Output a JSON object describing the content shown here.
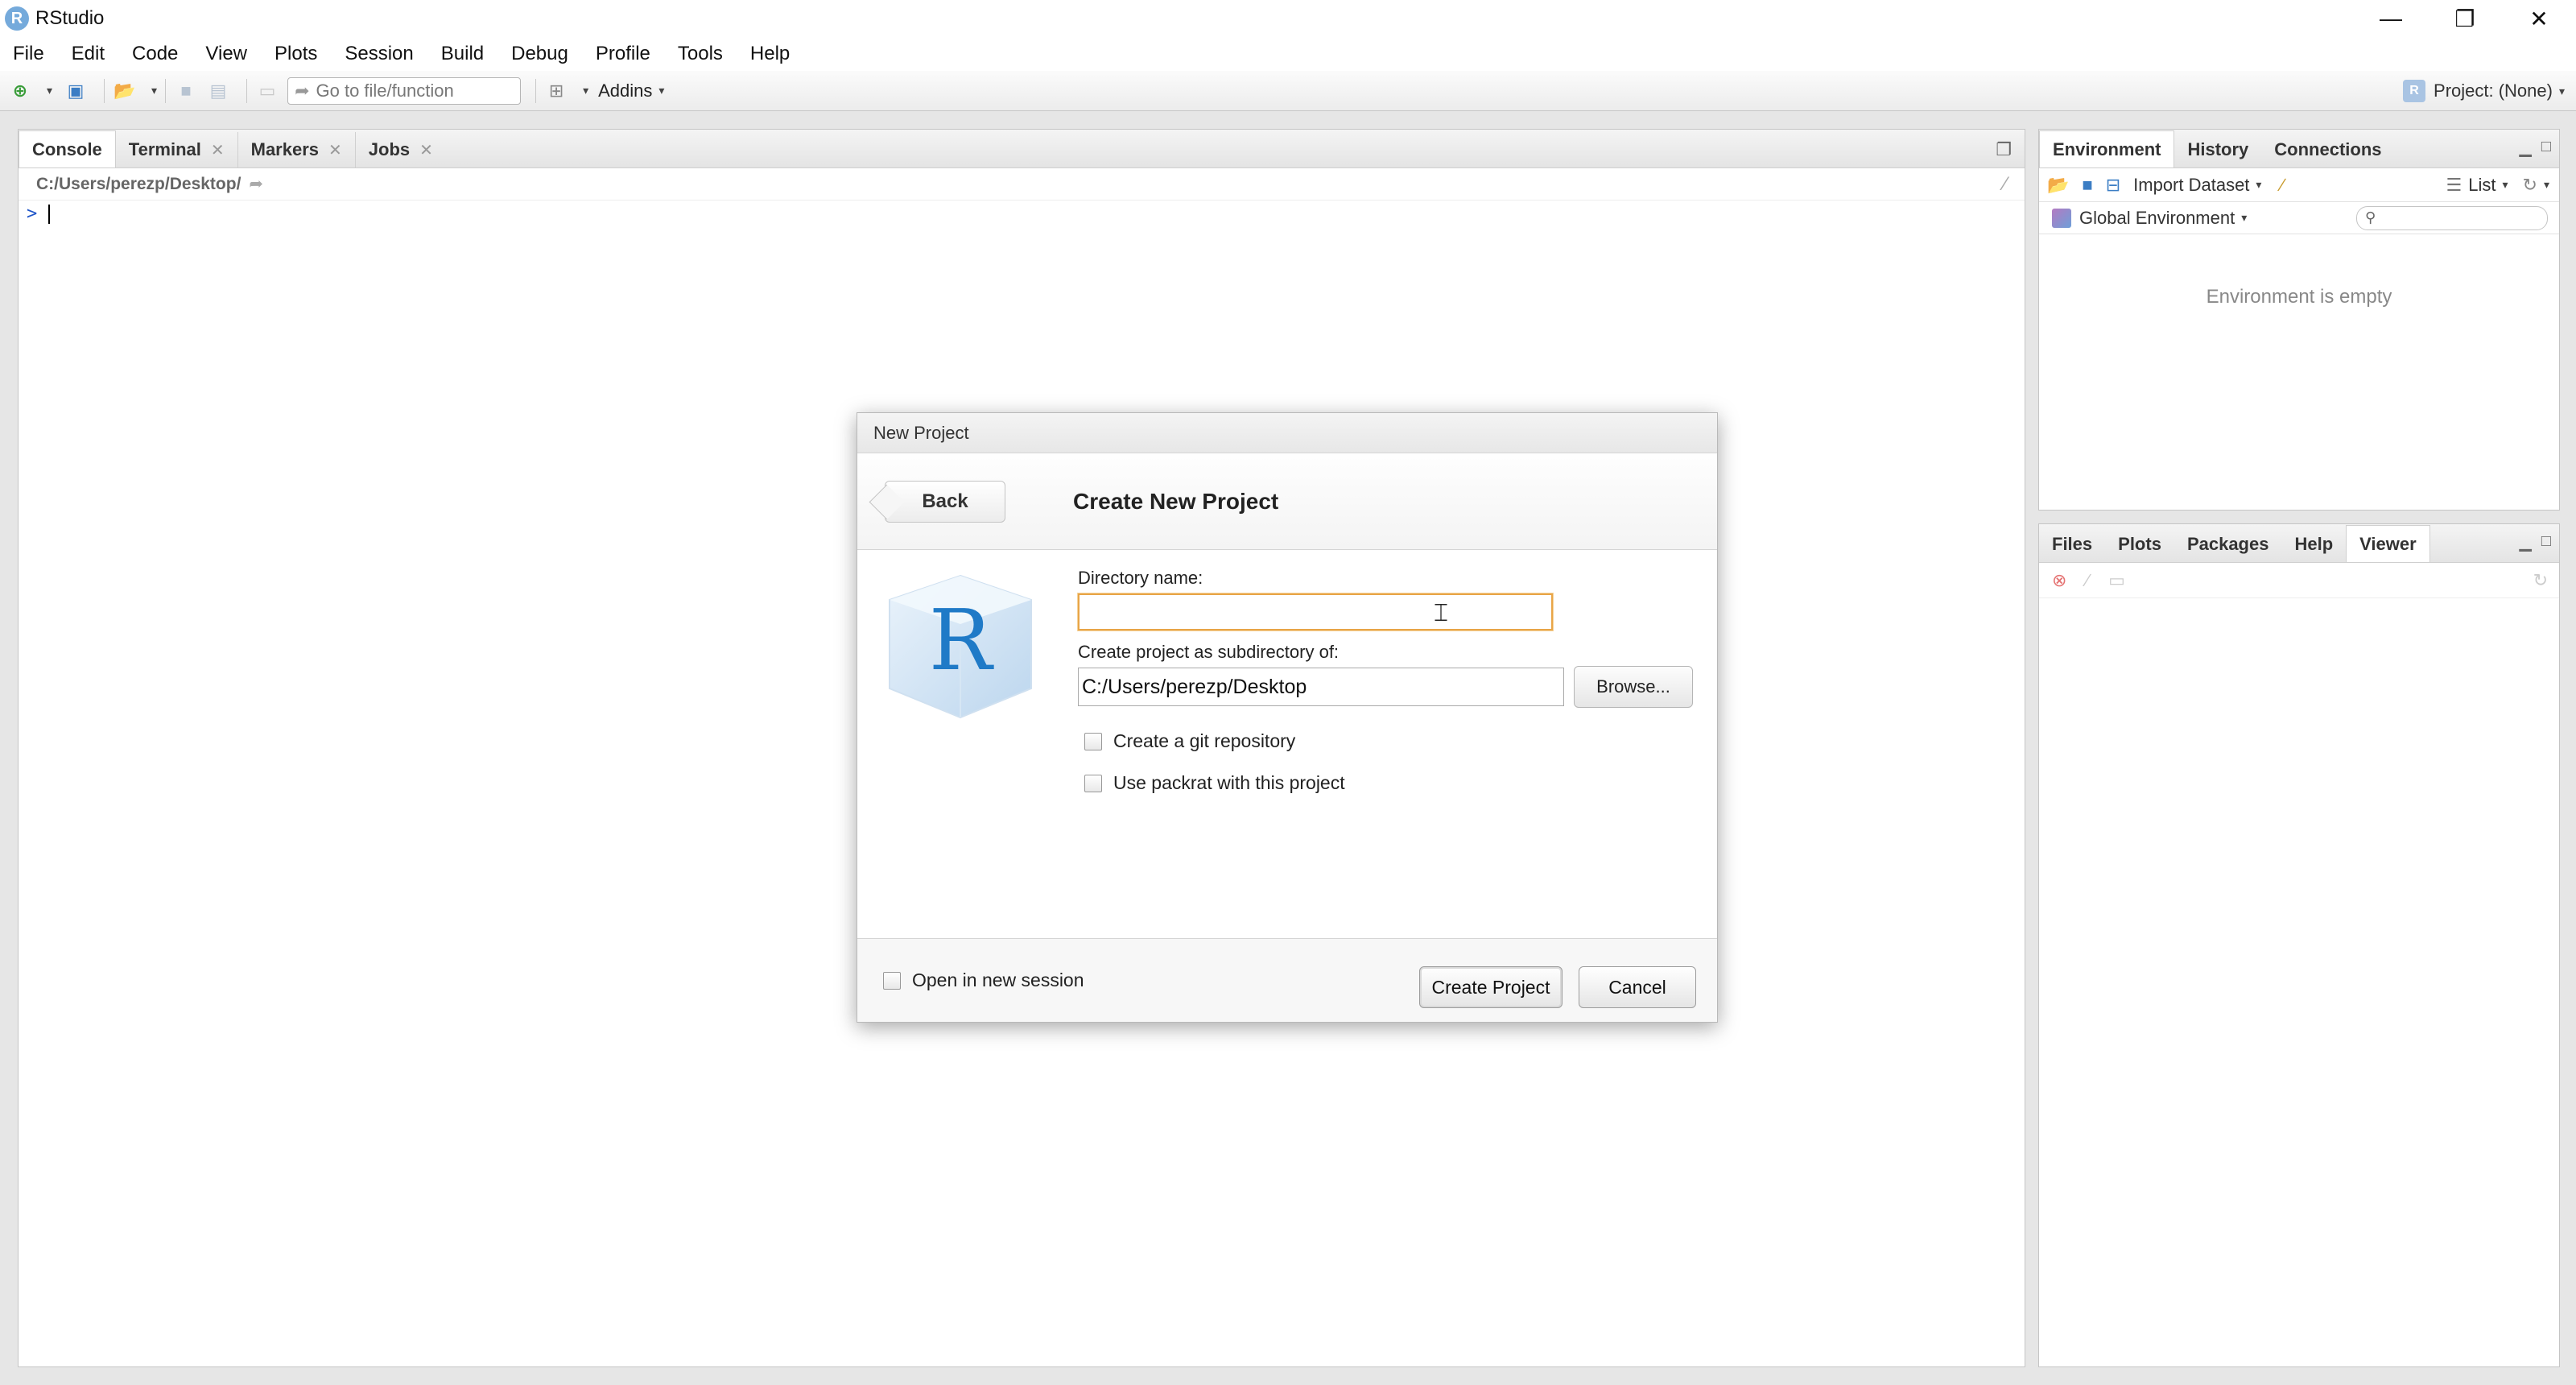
{
  "window": {
    "title": "RStudio",
    "logo": "R",
    "controls": [
      "minimize-icon",
      "restore-icon",
      "close-icon"
    ]
  },
  "menu": [
    "File",
    "Edit",
    "Code",
    "View",
    "Plots",
    "Session",
    "Build",
    "Debug",
    "Profile",
    "Tools",
    "Help"
  ],
  "toolbar": {
    "goto_placeholder": "Go to file/function",
    "addins_label": "Addins",
    "project_label": "Project: (None)",
    "project_logo": "R"
  },
  "left_pane": {
    "tabs": [
      {
        "label": "Console",
        "closable": false
      },
      {
        "label": "Terminal",
        "closable": true
      },
      {
        "label": "Markers",
        "closable": true
      },
      {
        "label": "Jobs",
        "closable": true
      }
    ],
    "path": "C:/Users/perezp/Desktop/",
    "prompt": ">"
  },
  "env_pane": {
    "tabs": [
      "Environment",
      "History",
      "Connections"
    ],
    "import_label": "Import Dataset",
    "list_label": "List",
    "scope_label": "Global Environment",
    "empty_text": "Environment is empty"
  },
  "files_pane": {
    "tabs": [
      "Files",
      "Plots",
      "Packages",
      "Help",
      "Viewer"
    ]
  },
  "dialog": {
    "title": "New Project",
    "back_label": "Back",
    "heading": "Create New Project",
    "logo_letter": "R",
    "dir_label": "Directory name:",
    "dir_value": "",
    "subdir_label": "Create project as subdirectory of:",
    "subdir_value": "C:/Users/perezp/Desktop",
    "browse_label": "Browse...",
    "git_label": "Create a git repository",
    "packrat_label": "Use packrat with this project",
    "new_session_label": "Open in new session",
    "create_label": "Create Project",
    "cancel_label": "Cancel"
  }
}
